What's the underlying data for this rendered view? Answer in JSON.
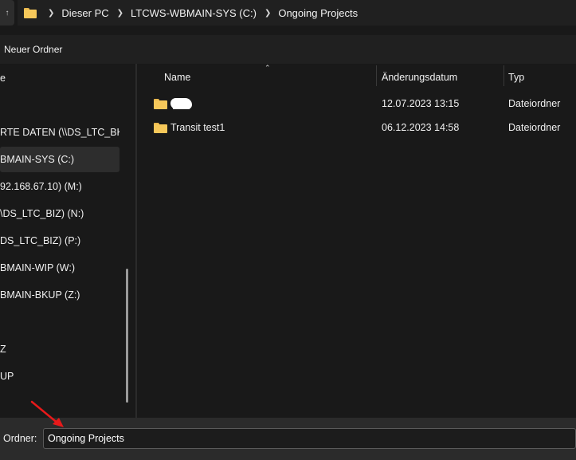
{
  "address_bar": {
    "breadcrumbs": [
      "Dieser PC",
      "LTCWS-WBMAIN-SYS (C:)",
      "Ongoing Projects"
    ]
  },
  "command_bar": {
    "new_folder_label": "Neuer Ordner"
  },
  "nav_pane": {
    "items": [
      {
        "label": "e"
      },
      {
        "label": "RTE DATEN (\\\\DS_LTC_BKUP"
      },
      {
        "label": "BMAIN-SYS (C:)",
        "selected": true
      },
      {
        "label": "92.168.67.10) (M:)"
      },
      {
        "label": "\\DS_LTC_BIZ) (N:)"
      },
      {
        "label": "DS_LTC_BIZ) (P:)"
      },
      {
        "label": "BMAIN-WIP (W:)"
      },
      {
        "label": "BMAIN-BKUP (Z:)"
      },
      {
        "label": "Z"
      },
      {
        "label": "UP"
      }
    ]
  },
  "file_list": {
    "columns": [
      "Name",
      "Änderungsdatum",
      "Typ"
    ],
    "rows": [
      {
        "name": "",
        "date": "12.07.2023 13:15",
        "type": "Dateiordner",
        "name_redacted": true
      },
      {
        "name": "Transit test1",
        "date": "06.12.2023 14:58",
        "type": "Dateiordner"
      }
    ]
  },
  "bottom_bar": {
    "folder_label": "Ordner:",
    "folder_value": "Ongoing Projects"
  },
  "colors": {
    "folder_yellow": "#f6c85a",
    "background": "#191919",
    "annotation_arrow": "#e8191a"
  }
}
